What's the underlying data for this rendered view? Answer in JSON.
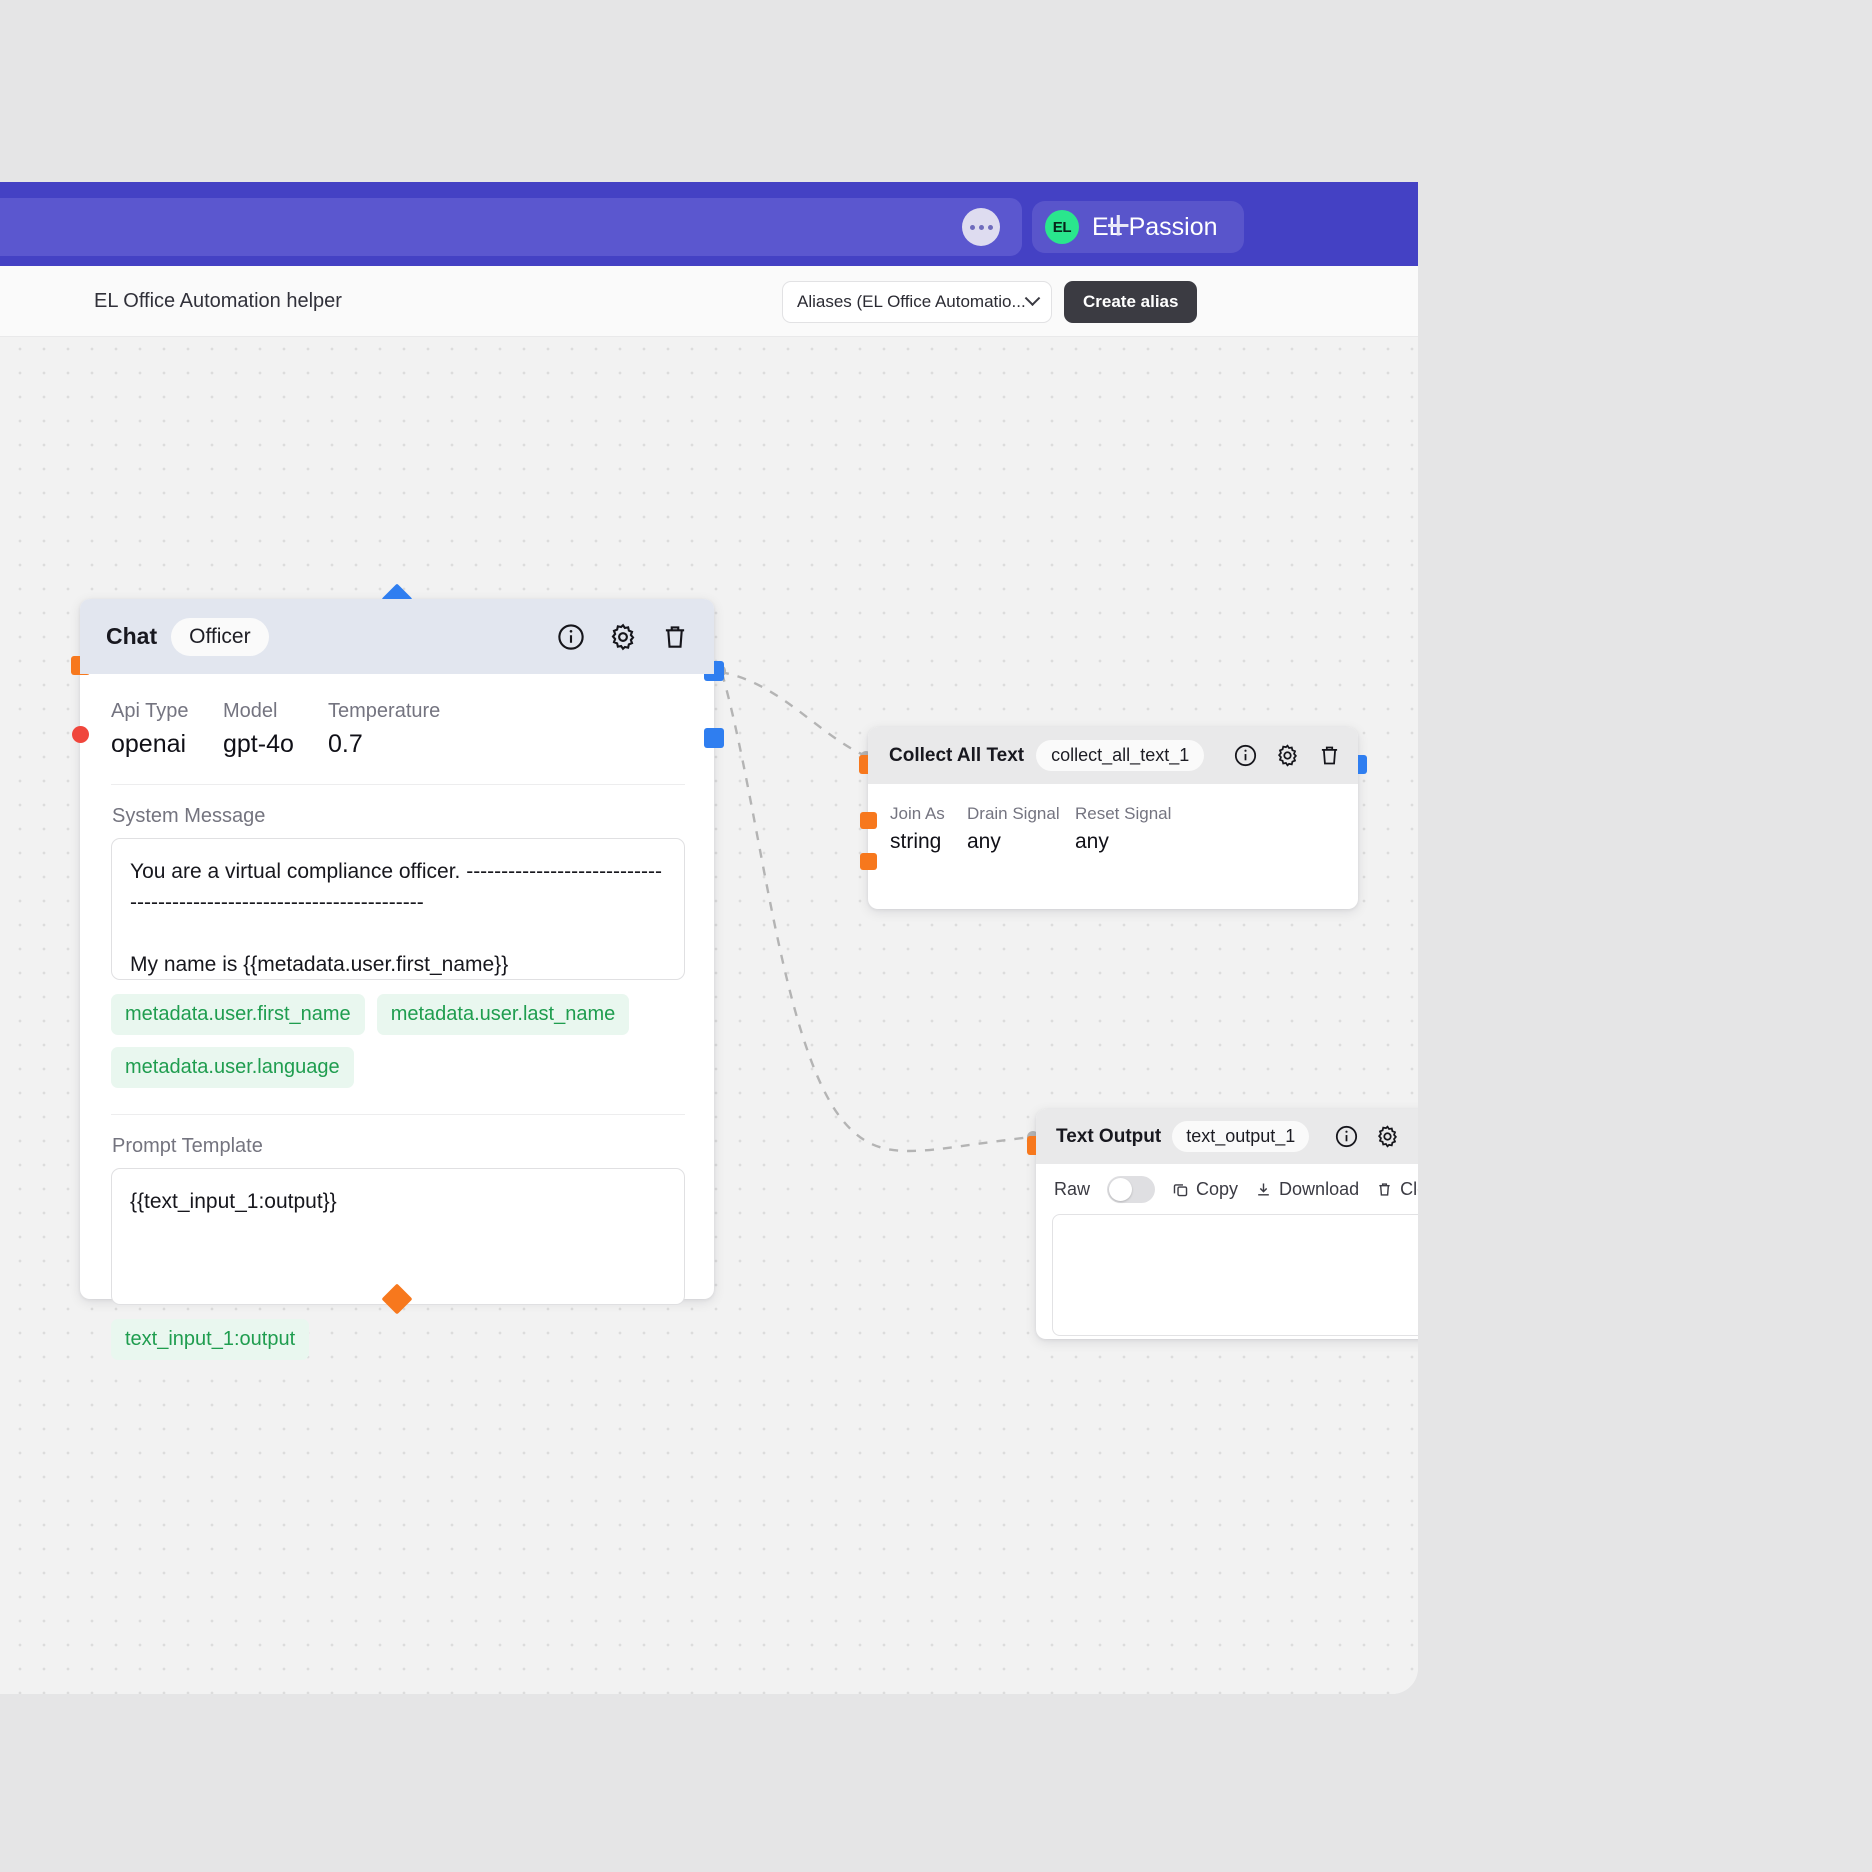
{
  "titlebar": {
    "overflow_icon": "ellipsis-icon",
    "workspace_initials": "EL",
    "workspace_name": "EL Passion",
    "new_tab_label": "+"
  },
  "toolbar": {
    "flow_title": "EL Office Automation helper",
    "alias_select_value": "Aliases (EL Office Automatio...",
    "create_alias_label": "Create alias"
  },
  "nodes": {
    "chat": {
      "title": "Chat",
      "chip": "Officer",
      "params": [
        {
          "label": "Api Type",
          "value": "openai"
        },
        {
          "label": "Model",
          "value": "gpt-4o"
        },
        {
          "label": "Temperature",
          "value": "0.7"
        }
      ],
      "system_message_label": "System Message",
      "system_message_value": "You are a virtual compliance officer. ----------------------------------------------------------------------\n\nMy name is {{metadata.user.first_name}}\n{{metadata.user.last_name}}",
      "system_chips": [
        "metadata.user.first_name",
        "metadata.user.last_name",
        "metadata.user.language"
      ],
      "prompt_template_label": "Prompt Template",
      "prompt_template_value": "{{text_input_1:output}}",
      "prompt_chips": [
        "text_input_1:output"
      ],
      "icons": [
        "info-icon",
        "gear-icon",
        "trash-icon"
      ]
    },
    "collect": {
      "title": "Collect All Text",
      "chip": "collect_all_text_1",
      "params": [
        {
          "label": "Join As",
          "value": "string"
        },
        {
          "label": "Drain Signal",
          "value": "any"
        },
        {
          "label": "Reset Signal",
          "value": "any"
        }
      ],
      "icons": [
        "info-icon",
        "gear-icon",
        "trash-icon"
      ]
    },
    "output": {
      "title": "Text Output",
      "chip": "text_output_1",
      "raw_label": "Raw",
      "raw_on": false,
      "copy_label": "Copy",
      "download_label": "Download",
      "clear_label": "Clear",
      "output_value": "",
      "icons": [
        "info-icon",
        "gear-icon",
        "trash-icon"
      ]
    }
  },
  "colors": {
    "titlebar": "#4441c4",
    "tab_active": "#5b57cf",
    "avatar": "#2ae68d",
    "accent_button": "#3b3b42",
    "port_orange": "#f7781d",
    "port_blue": "#2f7ef0",
    "port_red": "#f0463c",
    "chip_green_text": "#1f9d4f",
    "chip_green_bg": "#e9f7ef",
    "node_header": "#e2e6ef",
    "canvas": "#f2f2f2"
  }
}
